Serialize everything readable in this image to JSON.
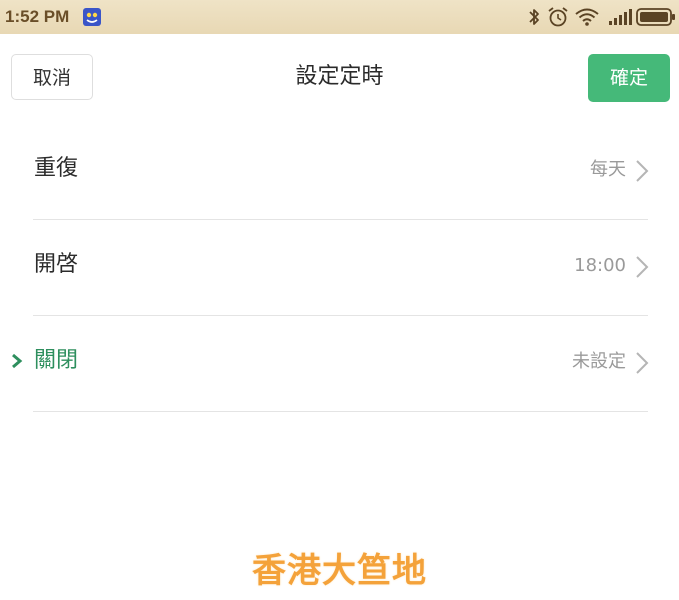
{
  "status_bar": {
    "time": "1:52 PM",
    "app_notification_icon": "app-notification-icon",
    "icons": [
      "bluetooth-icon",
      "alarm-clock-icon",
      "wifi-icon",
      "signal-icon",
      "battery-icon"
    ]
  },
  "header": {
    "cancel_label": "取消",
    "title": "設定定時",
    "confirm_label": "確定"
  },
  "rows": [
    {
      "label": "重復",
      "value": "每天",
      "active": false
    },
    {
      "label": "開啓",
      "value": "18:00",
      "active": false
    },
    {
      "label": "關閉",
      "value": "未設定",
      "active": true
    }
  ],
  "watermark": "香港大笪地",
  "colors": {
    "accent": "#45b979",
    "active_text": "#2e8f5e",
    "status_bar": "#ecdfc0",
    "watermark": "#f4a23a"
  }
}
